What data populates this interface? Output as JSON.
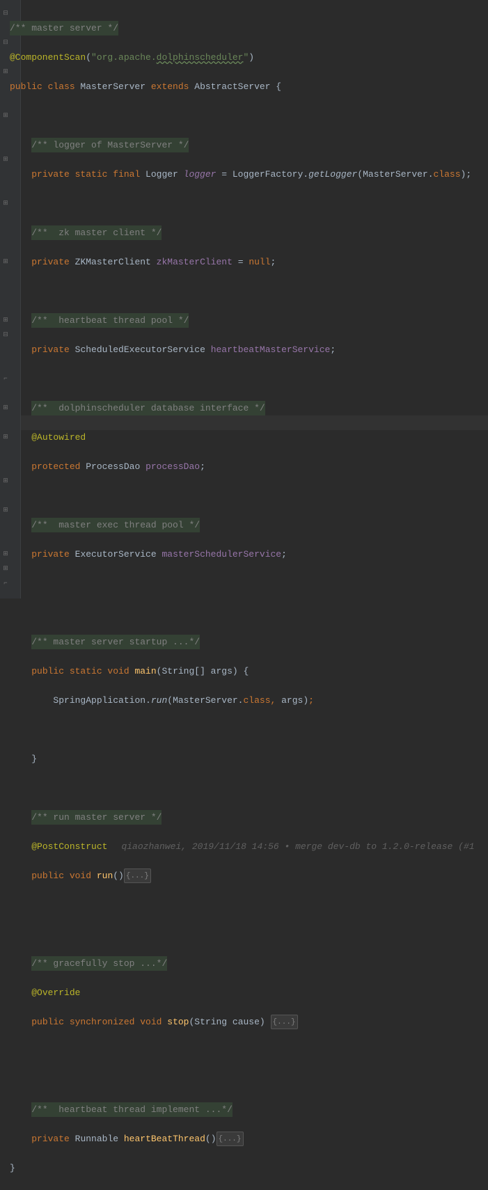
{
  "code": {
    "c1": "/** master server */",
    "c2a": "@ComponentScan",
    "c2b": "(",
    "c2c": "\"org.apache.",
    "c2d": "dolphinscheduler",
    "c2e": "\"",
    "c2f": ")",
    "c3a": "public class ",
    "c3b": "MasterServer ",
    "c3c": "extends ",
    "c3d": "AbstractServer {",
    "c5": "/** logger of MasterServer */",
    "c6a": "private static final ",
    "c6b": "Logger ",
    "c6c": "logger ",
    "c6d": "= LoggerFactory.",
    "c6e": "getLogger",
    "c6f": "(MasterServer.",
    "c6g": "class",
    "c6h": ");",
    "c8": "/**  zk master client */",
    "c9a": "private ",
    "c9b": "ZKMasterClient ",
    "c9c": "zkMasterClient ",
    "c9d": "= ",
    "c9e": "null",
    "c9f": ";",
    "c11": "/**  heartbeat thread pool */",
    "c12a": "private ",
    "c12b": "ScheduledExecutorService ",
    "c12c": "heartbeatMasterService",
    "c12d": ";",
    "c14": "/**  dolphinscheduler database interface */",
    "c15": "@Autowired",
    "c16a": "protected ",
    "c16b": "ProcessDao ",
    "c16c": "processDao",
    "c16d": ";",
    "c18": "/**  master exec thread pool */",
    "c19a": "private ",
    "c19b": "ExecutorService ",
    "c19c": "masterSchedulerService",
    "c19d": ";",
    "c22": "/** master server startup ...*/",
    "c23a": "public static void ",
    "c23b": "main",
    "c23c": "(String[] args) {",
    "c24a": "    SpringApplication.",
    "c24b": "run",
    "c24c": "(MasterServer.",
    "c24d": "class, ",
    "c24e": "args",
    "c24f": ")",
    "c24g": ";",
    "c26": "}",
    "c28": "/** run master server */",
    "c29": "@PostConstruct",
    "c29blame": "qiaozhanwei, 2019/11/18 14:56 • merge dev-db to 1.2.0-release (#1",
    "c30a": "public void ",
    "c30b": "run",
    "c30c": "()",
    "c30d": "{...}",
    "c33": "/** gracefully stop ...*/",
    "c34": "@Override",
    "c35a": "public synchronized void ",
    "c35b": "stop",
    "c35c": "(String cause) ",
    "c35d": "{...}",
    "c38": "/**  heartbeat thread implement ...*/",
    "c39a": "private ",
    "c39b": "Runnable ",
    "c39c": "heartBeatThread",
    "c39d": "()",
    "c39e": "{...}",
    "c40": "}"
  },
  "indent1": "    ",
  "fold": {
    "minus": "⊟",
    "plus": "⊞",
    "end": "⌐"
  }
}
